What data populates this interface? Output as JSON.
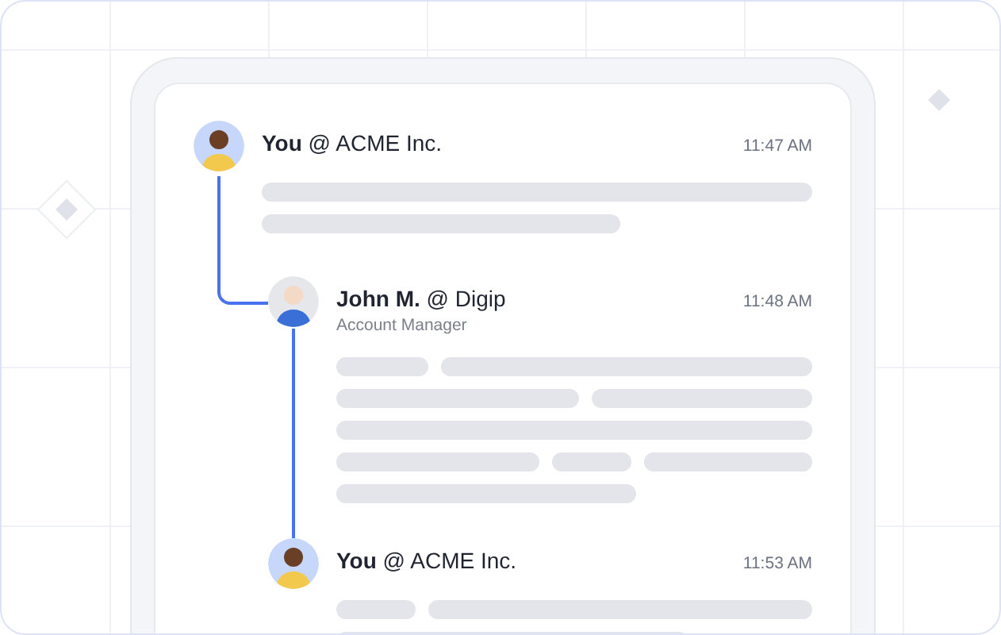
{
  "thread": [
    {
      "author": "**You** @ ACME Inc.",
      "time": "11:47 AM",
      "kind": "you",
      "children": [
        {
          "author": "**John M.** @ Digip",
          "subtitle": "Account Manager",
          "time": "11:48 AM",
          "kind": "john"
        },
        {
          "author": "**You** @ ACME Inc.",
          "time": "11:53 AM",
          "kind": "you"
        }
      ]
    }
  ]
}
